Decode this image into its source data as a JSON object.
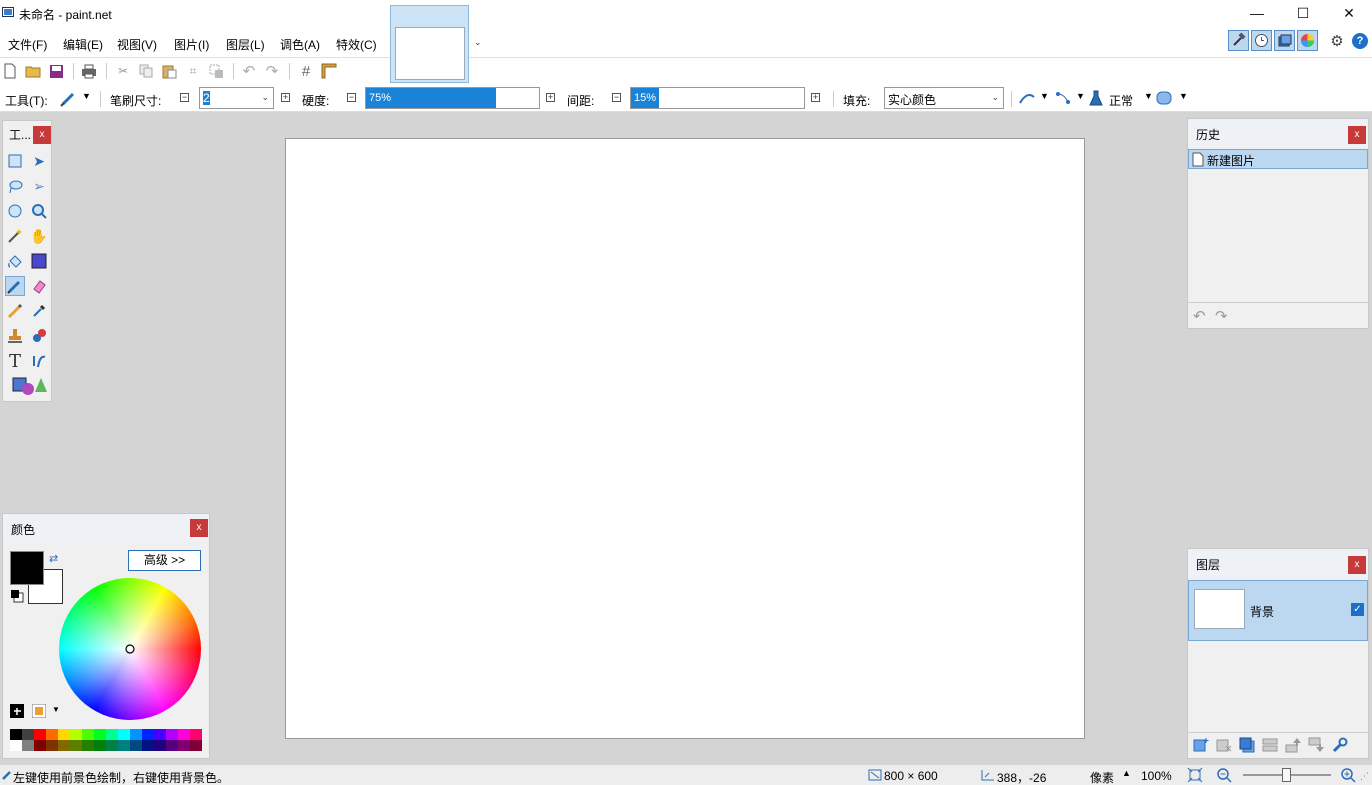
{
  "window": {
    "title": "未命名 - paint.net",
    "minimize": "—",
    "maximize": "☐",
    "close": "✕"
  },
  "menu": [
    "文件(F)",
    "编辑(E)",
    "视图(V)",
    "图片(I)",
    "图层(L)",
    "调色(A)",
    "特效(C)"
  ],
  "tool_options": {
    "tool_label": "工具(T):",
    "brush_label": "笔刷尺寸:",
    "brush_size": "2",
    "hardness_label": "硬度:",
    "hardness_value": "75%",
    "hardness_fraction": 0.75,
    "spacing_label": "间距:",
    "spacing_value": "15%",
    "spacing_fraction": 0.15,
    "fill_label": "填充:",
    "fill_value": "实心颜色",
    "blend_mode": "正常"
  },
  "tools_panel": {
    "title": "工..."
  },
  "colors_panel": {
    "title": "颜色",
    "advanced_button": "高级 >>",
    "primary_color": "#000000",
    "secondary_color": "#ffffff",
    "palette_top": [
      "#000000",
      "#404040",
      "#ff0000",
      "#ff6a00",
      "#ffd800",
      "#b6ff00",
      "#4cff00",
      "#00ff21",
      "#00ff90",
      "#00ffff",
      "#0094ff",
      "#0026ff",
      "#4800ff",
      "#b200ff",
      "#ff00dc",
      "#ff006e"
    ],
    "palette_bottom": [
      "#ffffff",
      "#808080",
      "#7f0000",
      "#7f3300",
      "#7f6a00",
      "#5b7f00",
      "#267f00",
      "#007f0e",
      "#007f46",
      "#007f7f",
      "#004a7f",
      "#00137f",
      "#21007f",
      "#57007f",
      "#7f006e",
      "#7f0037"
    ]
  },
  "history_panel": {
    "title": "历史",
    "items": [
      "新建图片"
    ]
  },
  "layers_panel": {
    "title": "图层",
    "layers": [
      {
        "name": "背景",
        "visible": true
      }
    ]
  },
  "status": {
    "hint": "左键使用前景色绘制，右键使用背景色。",
    "image_size": "800 × 600",
    "cursor_pos": "388，-26",
    "units": "像素",
    "zoom": "100%"
  },
  "colors": {
    "accent": "#1a83d8",
    "selection": "#bcd8f0",
    "close": "#c73a3a"
  }
}
